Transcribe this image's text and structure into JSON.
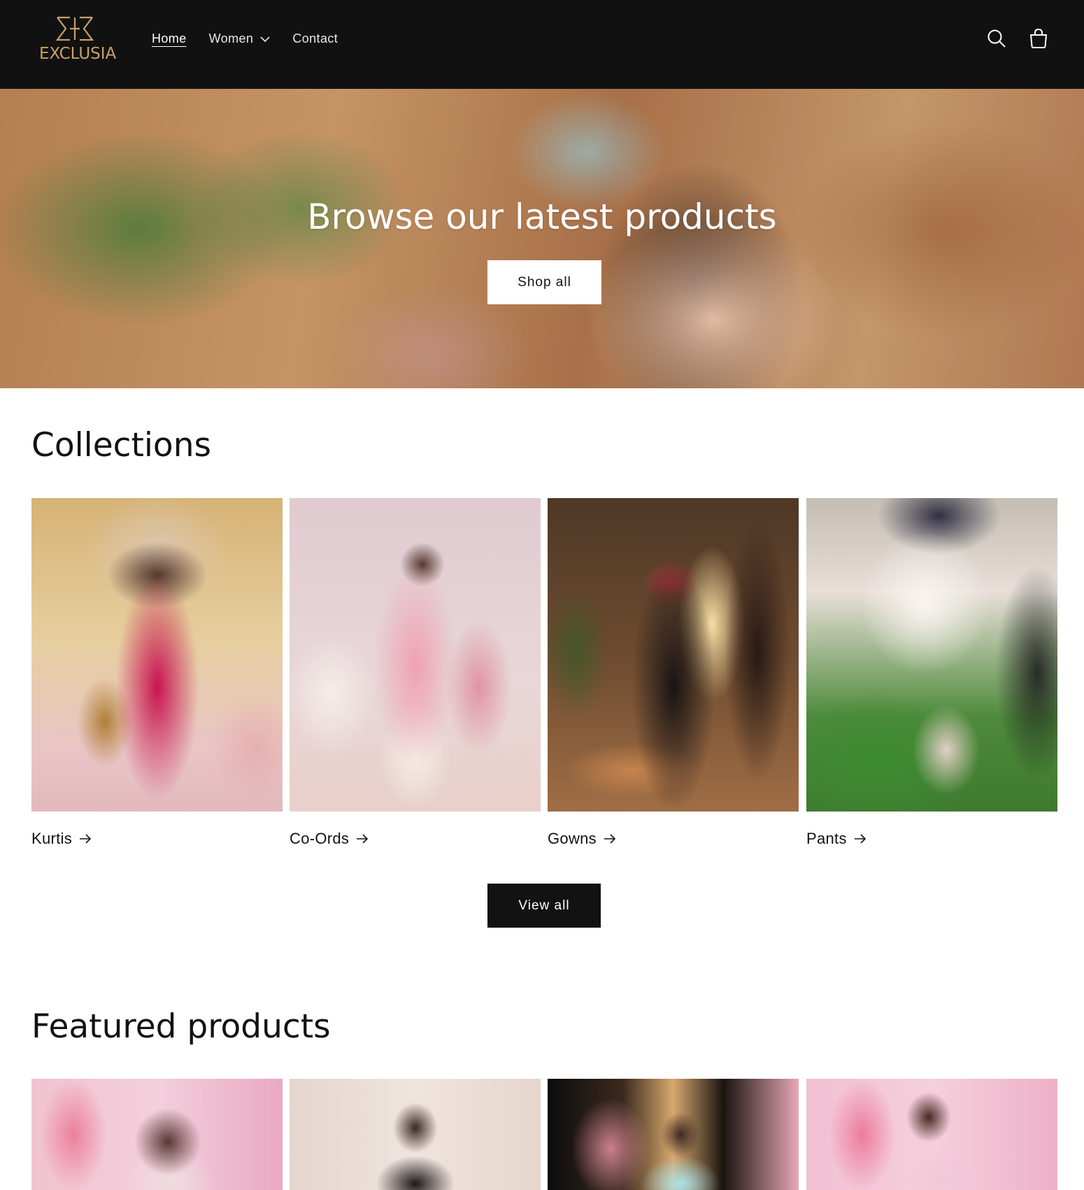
{
  "header": {
    "logo_text": "EXCLUSIA",
    "nav": [
      {
        "label": "Home",
        "active": true
      },
      {
        "label": "Women",
        "has_dropdown": true
      },
      {
        "label": "Contact"
      }
    ],
    "icons": [
      "search-icon",
      "cart-icon"
    ]
  },
  "hero": {
    "title": "Browse our latest products",
    "button_label": "Shop all"
  },
  "collections": {
    "title": "Collections",
    "items": [
      {
        "label": "Kurtis"
      },
      {
        "label": "Co-Ords"
      },
      {
        "label": "Gowns"
      },
      {
        "label": "Pants"
      }
    ],
    "view_all_label": "View all"
  },
  "featured": {
    "title": "Featured products"
  },
  "colors": {
    "header_bg": "#111111",
    "logo_gold": "#c9a06a",
    "primary_button_bg": "#121212",
    "secondary_button_bg": "#ffffff"
  }
}
